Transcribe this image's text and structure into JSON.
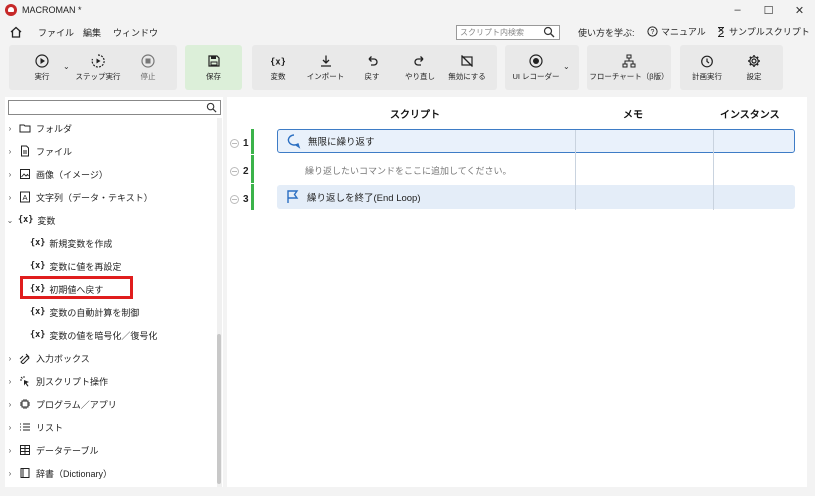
{
  "app": {
    "title": "MACROMAN *"
  },
  "window_controls": [
    "–",
    "☐",
    "✕"
  ],
  "menu": {
    "items": [
      "ファイル",
      "編集",
      "ウィンドウ"
    ]
  },
  "search": {
    "placeholder": "スクリプト内検索"
  },
  "learn": {
    "label": "使い方を学ぶ:",
    "manual": "マニュアル",
    "sample": "サンプルスクリプト"
  },
  "toolbar": {
    "run": "実行",
    "step_run": "ステップ実行",
    "stop": "停止",
    "save": "保存",
    "variable": "変数",
    "import": "インポート",
    "undo": "戻す",
    "redo": "やり直し",
    "disable": "無効にする",
    "ui_recorder": "UI レコーダー",
    "flowchart": "フローチャート（β版）",
    "schedule": "計画実行",
    "settings": "設定"
  },
  "tree": {
    "items": [
      {
        "label": "フォルダ",
        "expanded": false,
        "icon": "folder-icon"
      },
      {
        "label": "ファイル",
        "expanded": false,
        "icon": "file-icon"
      },
      {
        "label": "画像（イメージ）",
        "expanded": false,
        "icon": "image-icon"
      },
      {
        "label": "文字列（データ・テキスト）",
        "expanded": false,
        "icon": "text-icon"
      },
      {
        "label": "変数",
        "expanded": true,
        "icon": "variable-icon",
        "children": [
          "新規変数を作成",
          "変数に値を再設定",
          "初期値へ戻す",
          "変数の自動計算を制御",
          "変数の値を暗号化／復号化"
        ]
      },
      {
        "label": "入力ボックス",
        "expanded": false,
        "icon": "input-box-icon"
      },
      {
        "label": "別スクリプト操作",
        "expanded": false,
        "icon": "script-op-icon"
      },
      {
        "label": "プログラム／アプリ",
        "expanded": false,
        "icon": "program-icon"
      },
      {
        "label": "リスト",
        "expanded": false,
        "icon": "list-icon"
      },
      {
        "label": "データテーブル",
        "expanded": false,
        "icon": "table-icon"
      },
      {
        "label": "辞書（Dictionary）",
        "expanded": false,
        "icon": "dictionary-icon"
      }
    ],
    "variable_prefix": "{x}"
  },
  "script": {
    "headers": {
      "script": "スクリプト",
      "memo": "メモ",
      "instance": "インスタンス"
    },
    "rows": [
      {
        "num": "1",
        "text": "無限に繰り返す"
      },
      {
        "num": "2",
        "text": "繰り返したいコマンドをここに追加してください。"
      },
      {
        "num": "3",
        "text": "繰り返しを終了(End Loop)"
      }
    ]
  },
  "colors": {
    "accent_green": "#3bb34a",
    "selection_blue": "#3e7cc6",
    "highlight_red": "#e01d1d",
    "row_bg": "#e4edf8"
  }
}
